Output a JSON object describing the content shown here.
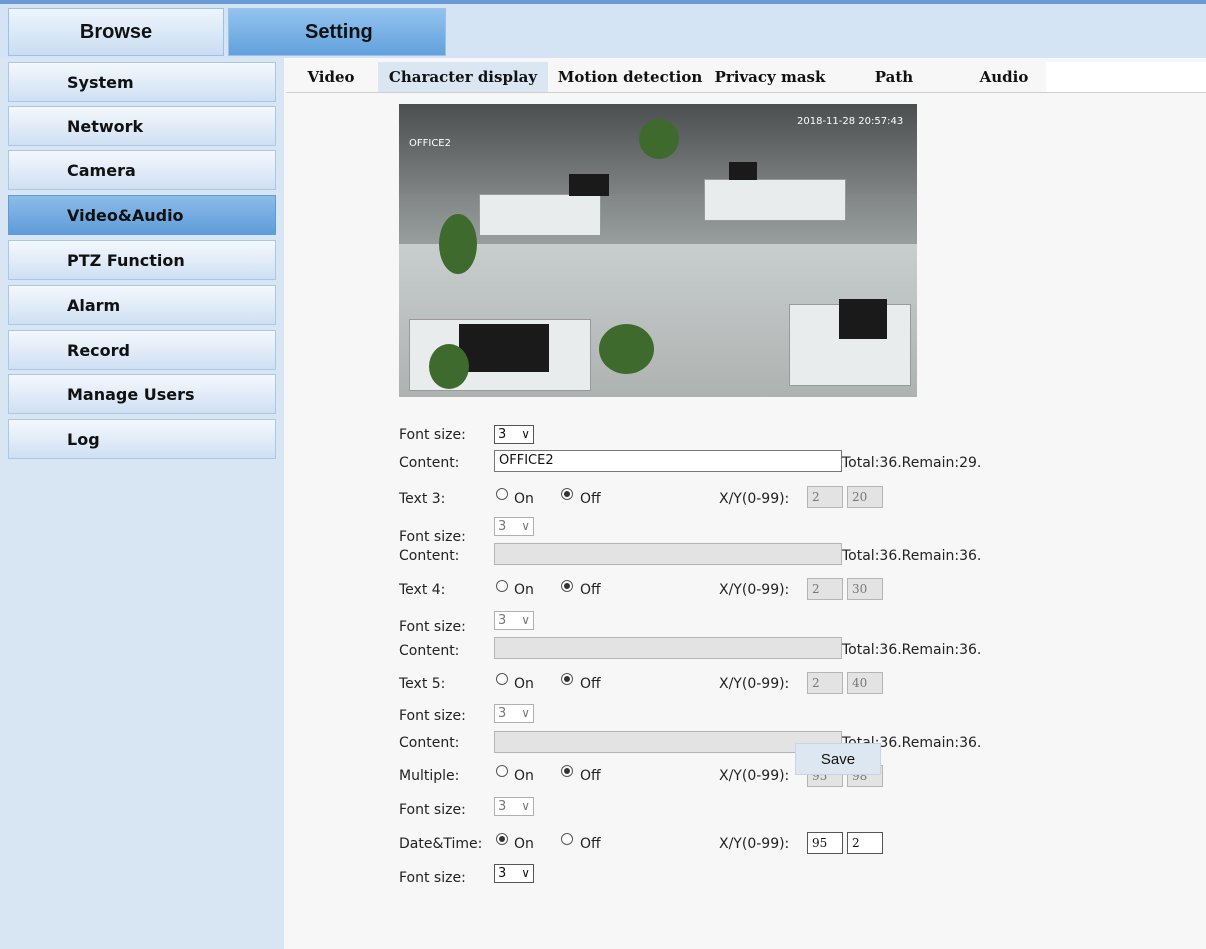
{
  "main_tabs": {
    "browse": "Browse",
    "setting": "Setting"
  },
  "sidebar": {
    "items": [
      {
        "label": "System"
      },
      {
        "label": "Network"
      },
      {
        "label": "Camera"
      },
      {
        "label": "Video&Audio",
        "active": true
      },
      {
        "label": "PTZ Function"
      },
      {
        "label": "Alarm"
      },
      {
        "label": "Record"
      },
      {
        "label": "Manage Users"
      },
      {
        "label": "Log"
      }
    ]
  },
  "subtabs": [
    "Video",
    "Character display",
    "Motion detection",
    "Privacy mask",
    "Path",
    "Audio"
  ],
  "active_subtab": "Character display",
  "preview": {
    "overlay_name": "OFFICE2",
    "overlay_datetime": "2018-11-28  20:57:43"
  },
  "form": {
    "font_size_label": "Font size:",
    "content_label": "Content:",
    "xy_label": "X/Y(0-99):",
    "on_label": "On",
    "off_label": "Off",
    "text2": {
      "font_size": "3",
      "content": "OFFICE2",
      "total": "Total:36.Remain:29."
    },
    "text3": {
      "label": "Text 3:",
      "state": "Off",
      "x": "2",
      "y": "20",
      "font_size": "3",
      "content": "",
      "total": "Total:36.Remain:36."
    },
    "text4": {
      "label": "Text 4:",
      "state": "Off",
      "x": "2",
      "y": "30",
      "font_size": "3",
      "content": "",
      "total": "Total:36.Remain:36."
    },
    "text5": {
      "label": "Text 5:",
      "state": "Off",
      "x": "2",
      "y": "40",
      "font_size": "3",
      "content": "",
      "total": "Total:36.Remain:36."
    },
    "multiple": {
      "label": "Multiple:",
      "state": "Off",
      "x": "95",
      "y": "98",
      "font_size": "3"
    },
    "datetime": {
      "label": "Date&Time:",
      "state": "On",
      "x": "95",
      "y": "2",
      "font_size": "3"
    }
  },
  "save_label": "Save",
  "colors": {
    "accent": "#6aa6e0",
    "panel": "#d8e6f4"
  }
}
